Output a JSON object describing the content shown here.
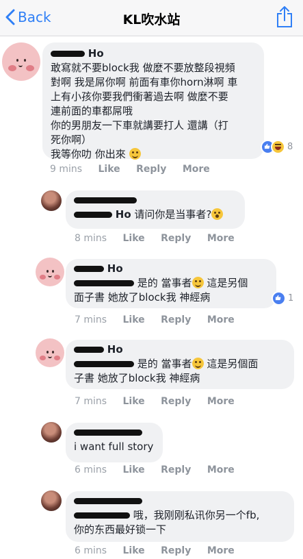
{
  "header": {
    "back_label": "Back",
    "title": "KL吹水站"
  },
  "comments": [
    {
      "name_suffix": "Ho",
      "lines": [
        "敢寫就不要block我 做麼不要放整段視頻",
        "對啊 我是屌你啊 前面有車你horn淋啊 車",
        "上有小孩你要我們衝著過去啊 做麼不要",
        "連前面的車都屌哦",
        "你的男朋友一下車就講要打人 還講（打",
        "死你啊）",
        "我等你叻 你出來"
      ],
      "time": "9 mins",
      "like": "Like",
      "reply": "Reply",
      "more": "More",
      "reaction_count": "8"
    },
    {
      "name_suffix": "Ho",
      "text": "请问你是当事者?",
      "time": "8 mins",
      "like": "Like",
      "reply": "Reply",
      "more": "More"
    },
    {
      "name_suffix": "Ho",
      "line1": "是的 當事者",
      "line1b": " 這是另個",
      "line2": "面子書 她放了block我 神經病",
      "time": "7 mins",
      "like": "Like",
      "reply": "Reply",
      "more": "More",
      "reaction_count": "1"
    },
    {
      "name_suffix": "Ho",
      "line1": "是的 當事者",
      "line1b": " 這是另個面",
      "line2": "子書 她放了block我 神經病",
      "time": "7 mins",
      "like": "Like",
      "reply": "Reply",
      "more": "More"
    },
    {
      "text": "i want full story",
      "time": "6 mins",
      "like": "Like",
      "reply": "Reply",
      "more": "More"
    },
    {
      "line1": "哦，我刚刚私讯你另一个fb,",
      "line2": "你的东西最好锁一下",
      "time": "6 mins",
      "like": "Like",
      "reply": "Reply",
      "more": "More"
    }
  ],
  "colors": {
    "accent": "#2f7ff6",
    "bubble": "#f0f1f3",
    "avatar_pink": "#f3c2c4"
  }
}
